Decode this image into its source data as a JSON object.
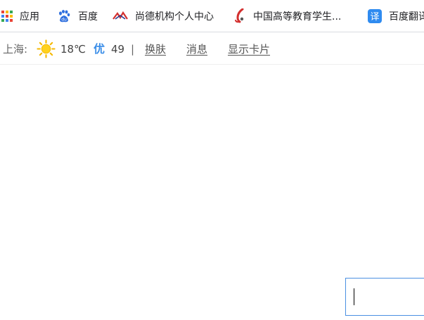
{
  "bookmarks": {
    "apps": "应用",
    "baidu": "百度",
    "shangde": "尚德机构个人中心",
    "chsi": "中国高等教育学生...",
    "fanyi": "百度翻译"
  },
  "weather": {
    "city": "上海:",
    "temperature": "18℃",
    "aqi_label": "优",
    "aqi_value": "49",
    "separator": "|"
  },
  "links": {
    "skin": "换肤",
    "messages": "消息",
    "show_card": "显示卡片"
  },
  "colors": {
    "accent": "#3b8ee8",
    "input_border": "#4a90e2"
  },
  "icons": [
    "apps-grid-icon",
    "baidu-paw-icon",
    "shangde-logo-icon",
    "chsi-logo-icon",
    "translate-icon",
    "sun-icon"
  ]
}
